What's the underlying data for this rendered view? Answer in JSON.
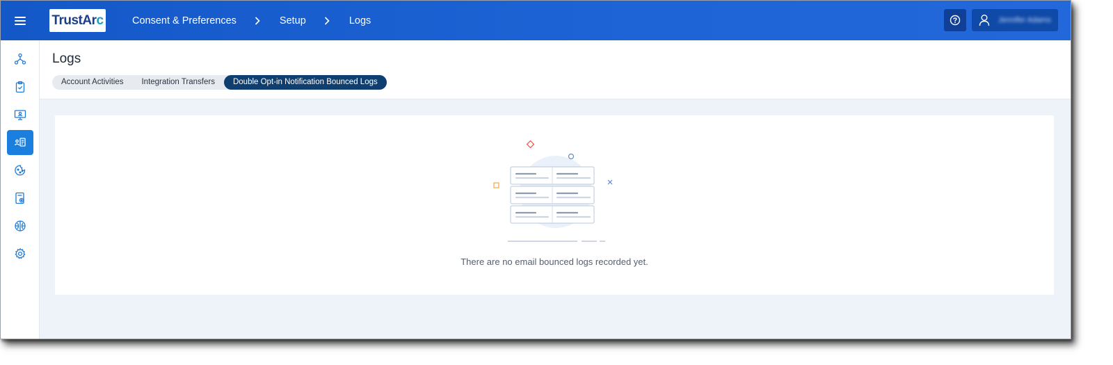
{
  "app": {
    "logo_text_main": "TrustAr",
    "logo_text_accent": "c"
  },
  "breadcrumb": [
    "Consent & Preferences",
    "Setup",
    "Logs"
  ],
  "header": {
    "help_icon": "help-circle-icon",
    "user_icon": "user-icon",
    "user_name": "Jennifer Adams"
  },
  "sidebar": {
    "items": [
      {
        "icon": "network-icon",
        "active": false
      },
      {
        "icon": "clipboard-check-icon",
        "active": false
      },
      {
        "icon": "monitor-icon",
        "active": false
      },
      {
        "icon": "user-document-icon",
        "active": true
      },
      {
        "icon": "globe-cookie-icon",
        "active": false
      },
      {
        "icon": "document-settings-icon",
        "active": false
      },
      {
        "icon": "brain-icon",
        "active": false
      },
      {
        "icon": "gear-icon",
        "active": false
      }
    ]
  },
  "page": {
    "title": "Logs",
    "tabs": [
      {
        "label": "Account Activities",
        "active": false
      },
      {
        "label": "Integration Transfers",
        "active": false
      },
      {
        "label": "Double Opt-in Notification Bounced Logs",
        "active": true
      }
    ]
  },
  "empty_state": {
    "message": "There are no email bounced logs recorded yet.",
    "illustration": "empty-table-illustration"
  },
  "colors": {
    "topbar": "#1e64d6",
    "active_tab": "#0e3f70",
    "active_sidebar": "#1b7fe0"
  }
}
